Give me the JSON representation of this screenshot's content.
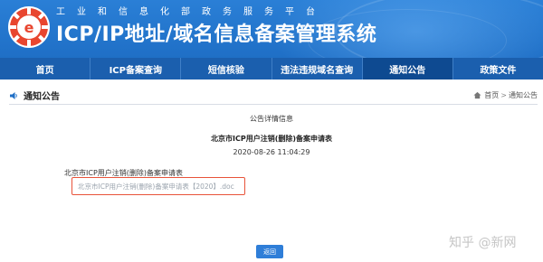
{
  "header": {
    "ministry_name": "工业和信息化部政务服务平台",
    "system_title": "ICP/IP地址/域名信息备案管理系统"
  },
  "nav": {
    "items": [
      {
        "label": "首页"
      },
      {
        "label": "ICP备案查询"
      },
      {
        "label": "短信核验"
      },
      {
        "label": "违法违规域名查询"
      },
      {
        "label": "通知公告",
        "active": true
      },
      {
        "label": "政策文件"
      }
    ]
  },
  "section": {
    "title": "通知公告",
    "breadcrumb": {
      "home": "首页",
      "separator": ">",
      "current": "通知公告"
    }
  },
  "article": {
    "detail_heading": "公告详情信息",
    "title": "北京市ICP用户注销(删除)备案申请表",
    "time": "2020-08-26 11:04:29",
    "body": "北京市ICP用户注销(删除)备案申请表",
    "attachment": "北京市ICP用户注销(删除)备案申请表【2020】.doc"
  },
  "actions": {
    "back_label": "返回"
  },
  "watermark": "知乎 @新网",
  "colors": {
    "header_blue": "#2a7fd6",
    "nav_blue": "#1b5fae",
    "nav_active": "#0e4a91",
    "attachment_outline": "#e8533a"
  }
}
